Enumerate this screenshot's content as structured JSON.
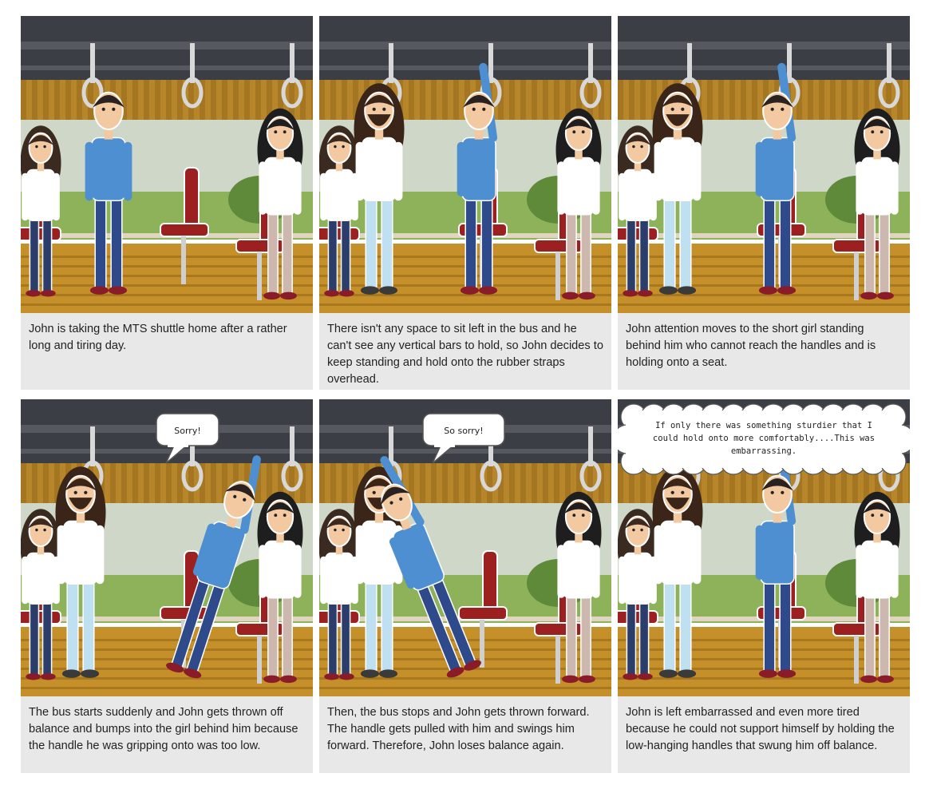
{
  "panels": [
    {
      "caption": "John is taking the MTS shuttle home after a rather long and tiring day.",
      "speech": "",
      "pose": "stand"
    },
    {
      "caption": "There isn't any space to sit left in the bus and he can't see any vertical bars to hold, so John decides to keep standing and hold onto the rubber straps overhead.",
      "speech": "",
      "pose": "stand"
    },
    {
      "caption": "John attention moves to the short girl standing behind him who cannot reach the handles and is holding onto a seat.",
      "speech": "",
      "pose": "hold"
    },
    {
      "caption": "The bus starts suddenly and John gets thrown off balance and bumps into the girl behind him because the handle he was gripping onto was too low.",
      "speech": "Sorry!",
      "pose": "fall-back"
    },
    {
      "caption": "Then, the bus stops and John gets thrown forward. The handle gets pulled with him and swings him forward. Therefore, John loses balance again.",
      "speech": "So sorry!",
      "pose": "fall-forward"
    },
    {
      "caption": "John is left embarrassed and even more tired because he could not support himself by holding the low-hanging handles that swung him off balance.",
      "speech": "",
      "thought_lines": [
        "If only there was something sturdier that I",
        "could hold onto more comfortably....This was",
        "embarrassing."
      ],
      "pose": "hold"
    }
  ],
  "colors": {
    "ceiling": "#3b3f45",
    "wall_wood": "#b8862a",
    "window_glass": "#cfd8c8",
    "seat_red": "#9c2020",
    "floor_wood": "#c58f2a",
    "john_shirt": "#4d8fd0",
    "john_pants": "#2f4a8a",
    "caption_bg": "#e8e8e8"
  }
}
